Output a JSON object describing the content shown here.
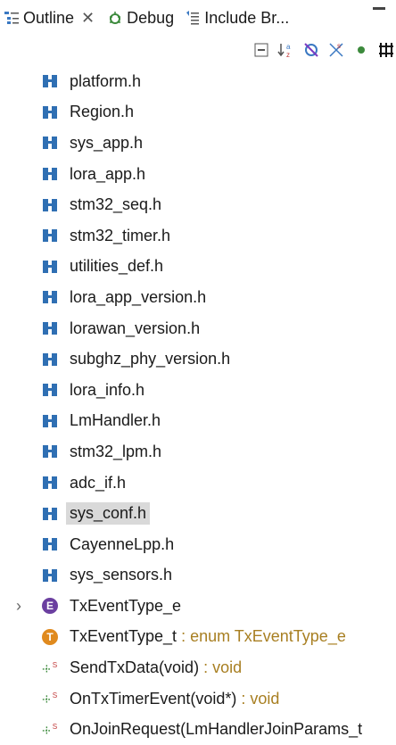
{
  "tabs": [
    {
      "label": "Outline",
      "icon": "outline-icon",
      "active": true
    },
    {
      "label": "Debug",
      "icon": "debug-icon"
    },
    {
      "label": "Include Br...",
      "icon": "include-browser-icon"
    }
  ],
  "toolbar": [
    "collapse-all-icon",
    "sort-icon",
    "hide-fields-icon",
    "hide-static-icon",
    "hide-nonpublic-icon",
    "hide-macros-icon"
  ],
  "tree": [
    {
      "label": "platform.h"
    },
    {
      "label": "Region.h"
    },
    {
      "label": "sys_app.h"
    },
    {
      "label": "lora_app.h"
    },
    {
      "label": "stm32_seq.h"
    },
    {
      "label": "stm32_timer.h"
    },
    {
      "label": "utilities_def.h"
    },
    {
      "label": "lora_app_version.h"
    },
    {
      "label": "lorawan_version.h"
    },
    {
      "label": "subghz_phy_version.h"
    },
    {
      "label": "lora_info.h"
    },
    {
      "label": "LmHandler.h"
    },
    {
      "label": "stm32_lpm.h"
    },
    {
      "label": "adc_if.h"
    },
    {
      "label": "sys_conf.h"
    },
    {
      "label": "CayenneLpp.h"
    },
    {
      "label": "sys_sensors.h"
    },
    {
      "label": "TxEventType_e"
    },
    {
      "label": "TxEventType_t",
      "type": " : enum TxEventType_e"
    },
    {
      "label": "SendTxData(void)",
      "type": " : void"
    },
    {
      "label": "OnTxTimerEvent(void*)",
      "type": " : void"
    },
    {
      "label": "OnJoinRequest(LmHandlerJoinParams_t"
    }
  ]
}
